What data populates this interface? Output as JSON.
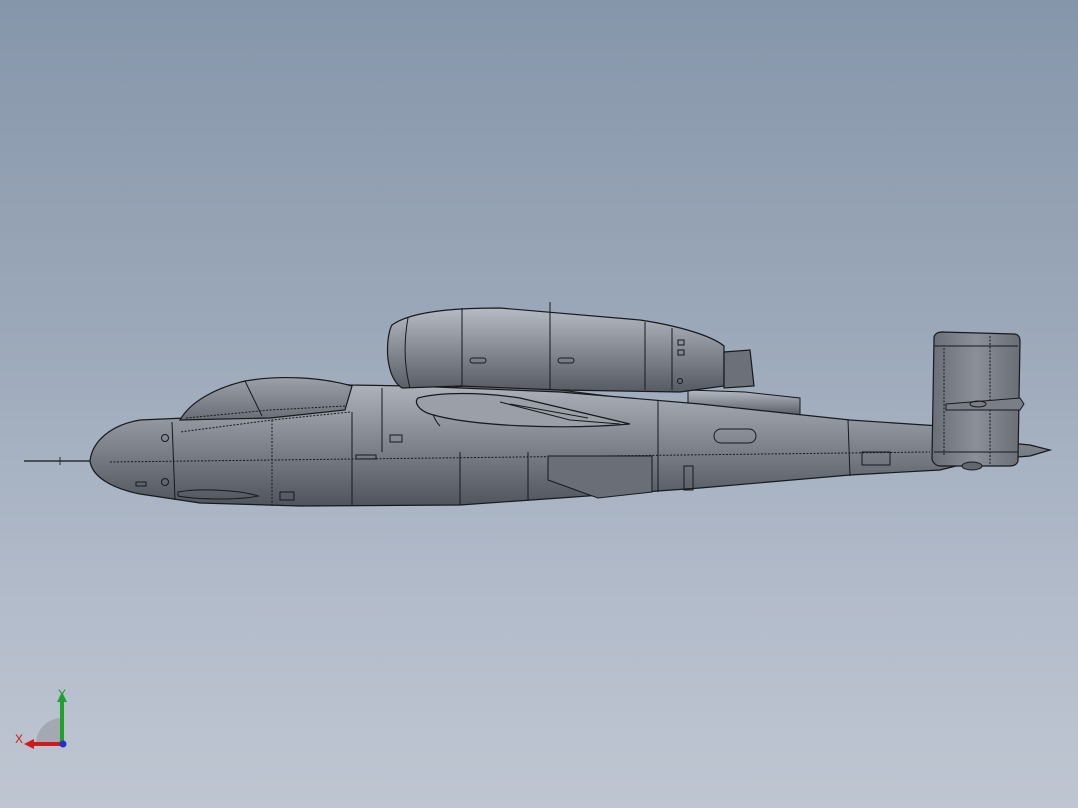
{
  "viewport": {
    "background_top": "#8696aa",
    "background_bottom": "#bfc6d2"
  },
  "model": {
    "body_color": "#7c818a",
    "edge_color": "#17191d",
    "highlight_color": "#aeb3bb",
    "shadow_color": "#4c5058"
  },
  "triad": {
    "x_label": "X",
    "y_label": "Y",
    "x_color": "#d11a1a",
    "y_color": "#1fa12c",
    "z_color": "#2332c8"
  }
}
